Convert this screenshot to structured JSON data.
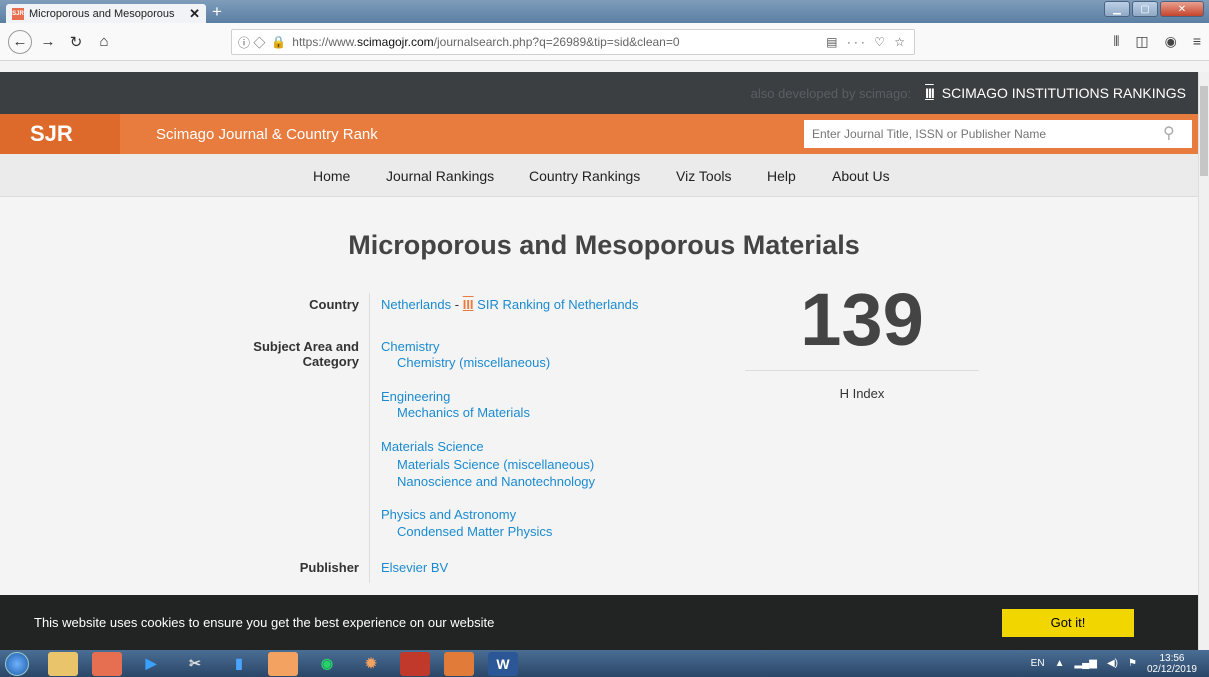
{
  "browser": {
    "tab_title": "Microporous and Mesoporous",
    "url_prefix": "https://www.",
    "url_domain": "scimagojr.com",
    "url_path": "/journalsearch.php?q=26989&tip=sid&clean=0",
    "new_tab": "+",
    "close": "✕"
  },
  "topband": {
    "also_text": "also developed by scimago:",
    "sir_label": "SCIMAGO INSTITUTIONS RANKINGS"
  },
  "header": {
    "logo": "SJR",
    "site_name": "Scimago Journal & Country Rank",
    "search_placeholder": "Enter Journal Title, ISSN or Publisher Name"
  },
  "nav": [
    "Home",
    "Journal Rankings",
    "Country Rankings",
    "Viz Tools",
    "Help",
    "About Us"
  ],
  "journal": {
    "title": "Microporous and Mesoporous Materials",
    "country_label": "Country",
    "country": "Netherlands",
    "country_sep": "-",
    "sir_link": "SIR Ranking of Netherlands",
    "subject_label_1": "Subject Area and",
    "subject_label_2": "Category",
    "subjects": [
      {
        "area": "Chemistry",
        "categories": [
          "Chemistry (miscellaneous)"
        ]
      },
      {
        "area": "Engineering",
        "categories": [
          "Mechanics of Materials"
        ]
      },
      {
        "area": "Materials Science",
        "categories": [
          "Materials Science (miscellaneous)",
          "Nanoscience and Nanotechnology"
        ]
      },
      {
        "area": "Physics and Astronomy",
        "categories": [
          "Condensed Matter Physics"
        ]
      }
    ],
    "publisher_label": "Publisher",
    "publisher": "Elsevier BV",
    "h_index": "139",
    "h_index_label": "H Index"
  },
  "cookie": {
    "message": "This website uses cookies to ensure you get the best experience on our website",
    "button": "Got it!"
  },
  "taskbar": {
    "lang": "EN",
    "time": "13:56",
    "date": "02/12/2019"
  }
}
